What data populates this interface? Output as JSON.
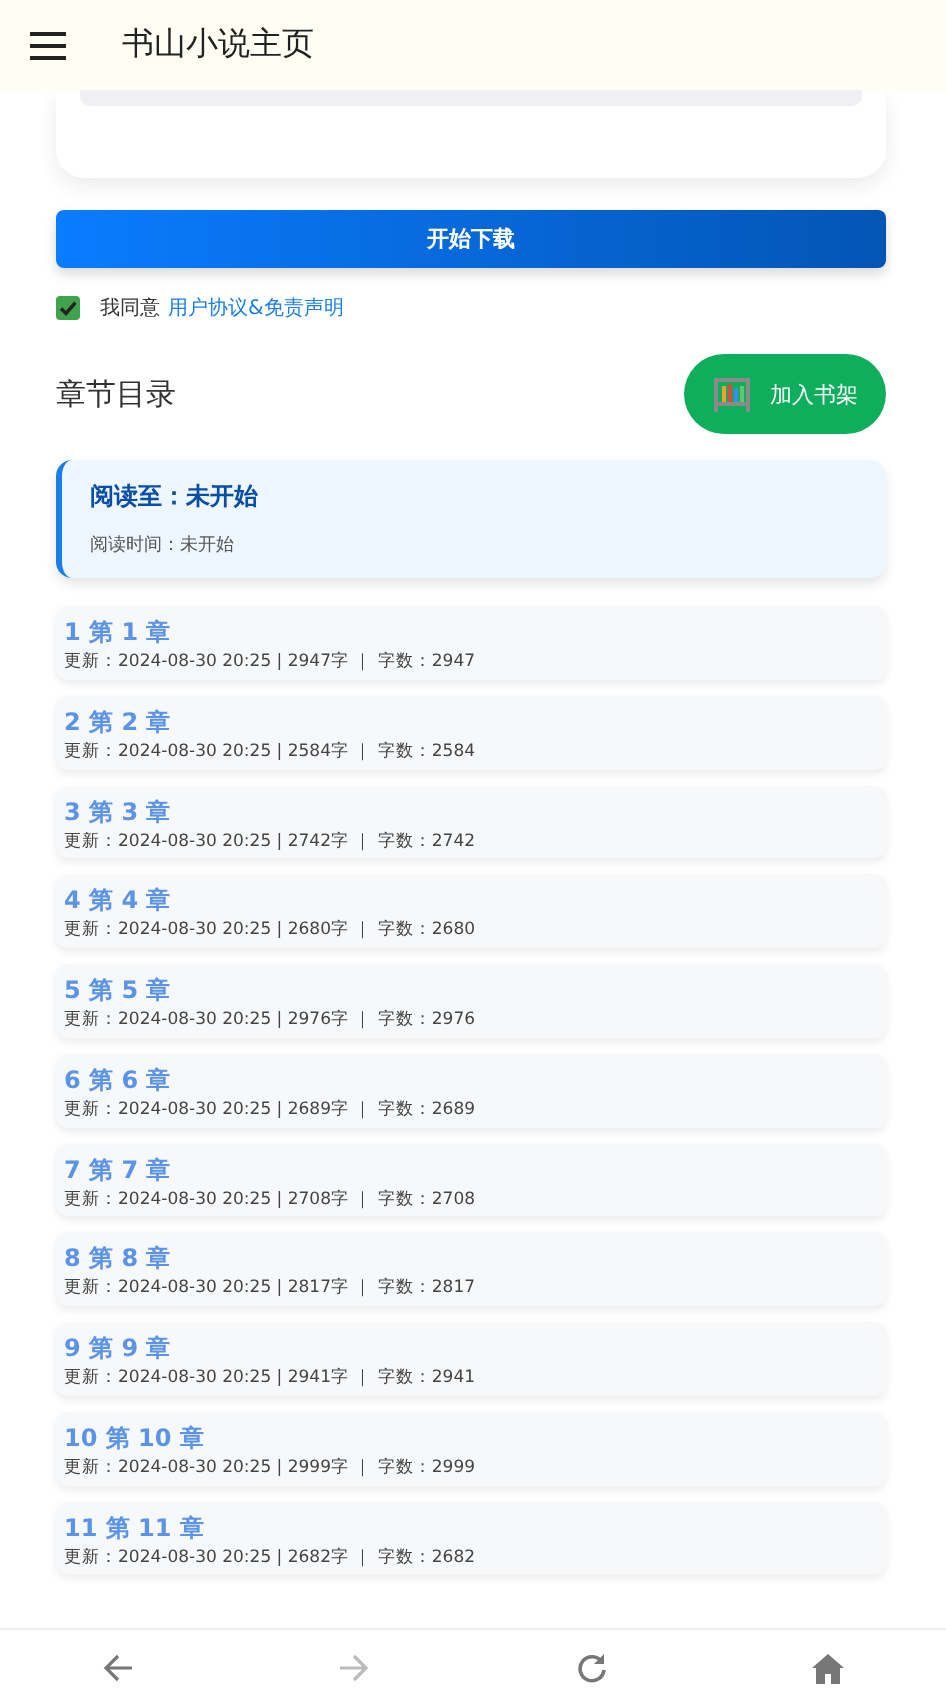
{
  "header": {
    "title": "书山小说主页"
  },
  "download_button": "开始下载",
  "agreement": {
    "checked": true,
    "text": "我同意",
    "link": "用户协议&免责声明"
  },
  "section_title": "章节目录",
  "shelf_button": "加入书架",
  "progress": {
    "title": "阅读至：未开始",
    "time": "阅读时间：未开始"
  },
  "chapters": [
    {
      "title": "1 第 1 章",
      "meta": "更新：2024-08-30 20:25 | 2947字 ｜ 字数：2947"
    },
    {
      "title": "2 第 2 章",
      "meta": "更新：2024-08-30 20:25 | 2584字 ｜ 字数：2584"
    },
    {
      "title": "3 第 3 章",
      "meta": "更新：2024-08-30 20:25 | 2742字 ｜ 字数：2742"
    },
    {
      "title": "4 第 4 章",
      "meta": "更新：2024-08-30 20:25 | 2680字 ｜ 字数：2680"
    },
    {
      "title": "5 第 5 章",
      "meta": "更新：2024-08-30 20:25 | 2976字 ｜ 字数：2976"
    },
    {
      "title": "6 第 6 章",
      "meta": "更新：2024-08-30 20:25 | 2689字 ｜ 字数：2689"
    },
    {
      "title": "7 第 7 章",
      "meta": "更新：2024-08-30 20:25 | 2708字 ｜ 字数：2708"
    },
    {
      "title": "8 第 8 章",
      "meta": "更新：2024-08-30 20:25 | 2817字 ｜ 字数：2817"
    },
    {
      "title": "9 第 9 章",
      "meta": "更新：2024-08-30 20:25 | 2941字 ｜ 字数：2941"
    },
    {
      "title": "10 第 10 章",
      "meta": "更新：2024-08-30 20:25 | 2999字 ｜ 字数：2999"
    },
    {
      "title": "11 第 11 章",
      "meta": "更新：2024-08-30 20:25 | 2682字 ｜ 字数：2682"
    }
  ],
  "nav": [
    {
      "kind": "back",
      "disabled": false
    },
    {
      "kind": "forward",
      "disabled": true
    },
    {
      "kind": "reload",
      "disabled": false
    },
    {
      "kind": "home",
      "disabled": false
    }
  ]
}
